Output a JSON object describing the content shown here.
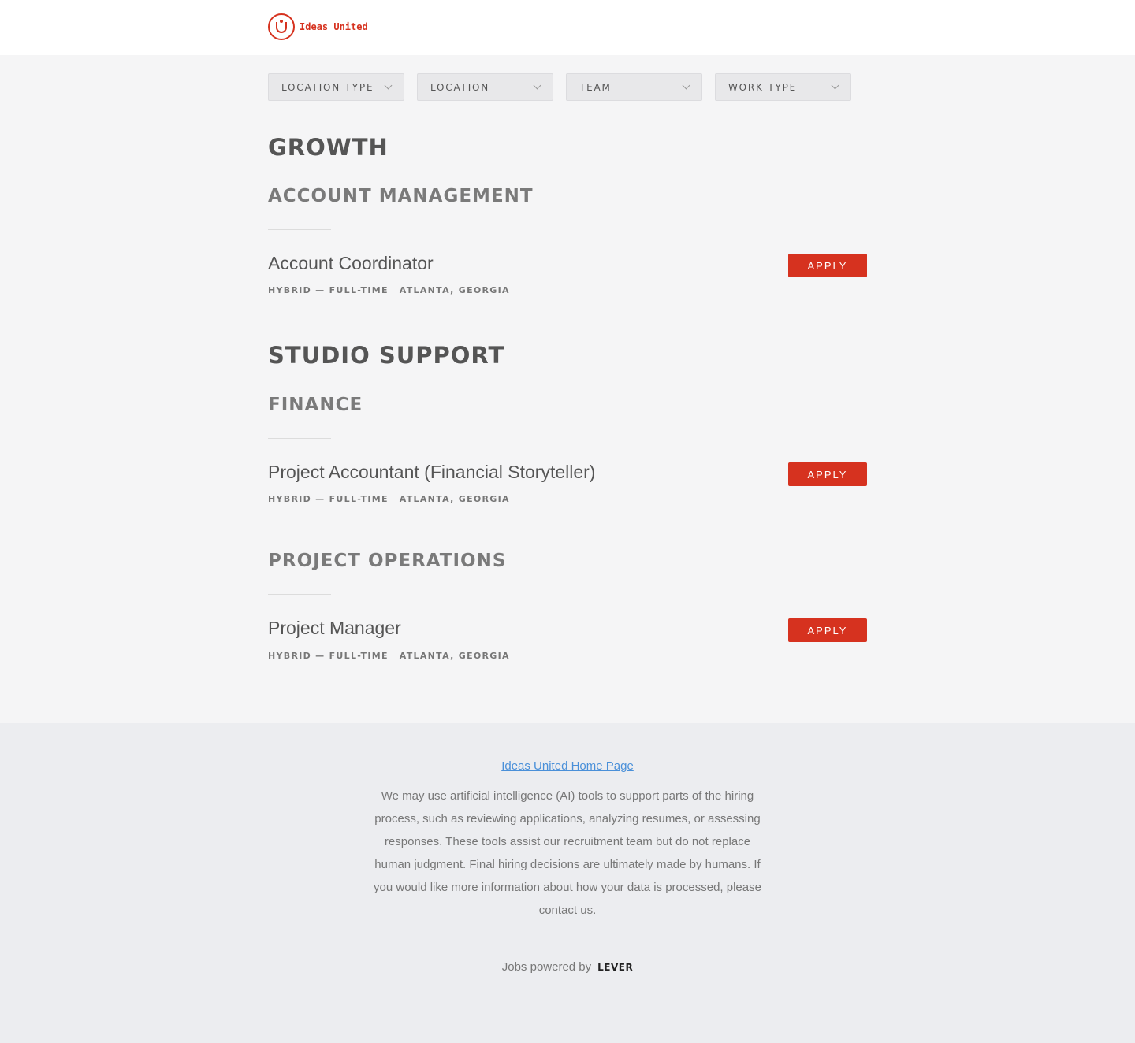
{
  "brand": {
    "name": "Ideas United",
    "color": "#d6321f"
  },
  "filters": [
    {
      "label": "LOCATION TYPE"
    },
    {
      "label": "LOCATION"
    },
    {
      "label": "TEAM"
    },
    {
      "label": "WORK TYPE"
    }
  ],
  "groups": [
    {
      "title": "GROWTH",
      "teams": [
        {
          "title": "ACCOUNT MANAGEMENT",
          "jobs": [
            {
              "title": "Account Coordinator",
              "work_type": "HYBRID — FULL-TIME",
              "location": "ATLANTA, GEORGIA",
              "apply_label": "APPLY"
            }
          ]
        }
      ]
    },
    {
      "title": "STUDIO SUPPORT",
      "teams": [
        {
          "title": "FINANCE",
          "jobs": [
            {
              "title": "Project Accountant (Financial Storyteller)",
              "work_type": "HYBRID — FULL-TIME",
              "location": "ATLANTA, GEORGIA",
              "apply_label": "APPLY"
            }
          ]
        },
        {
          "title": "PROJECT OPERATIONS",
          "jobs": [
            {
              "title": "Project Manager",
              "work_type": "HYBRID — FULL-TIME",
              "location": "ATLANTA, GEORGIA",
              "apply_label": "APPLY"
            }
          ]
        }
      ]
    }
  ],
  "footer": {
    "home_link": "Ideas United Home Page",
    "ai_note": "We may use artificial intelligence (AI) tools to support parts of the hiring process, such as reviewing applications, analyzing resumes, or assessing responses. These tools assist our recruitment team but do not replace human judgment. Final hiring decisions are ultimately made by humans. If you would like more information about how your data is processed, please contact us.",
    "powered_by": "Jobs powered by",
    "powered_brand": "LEVER"
  }
}
